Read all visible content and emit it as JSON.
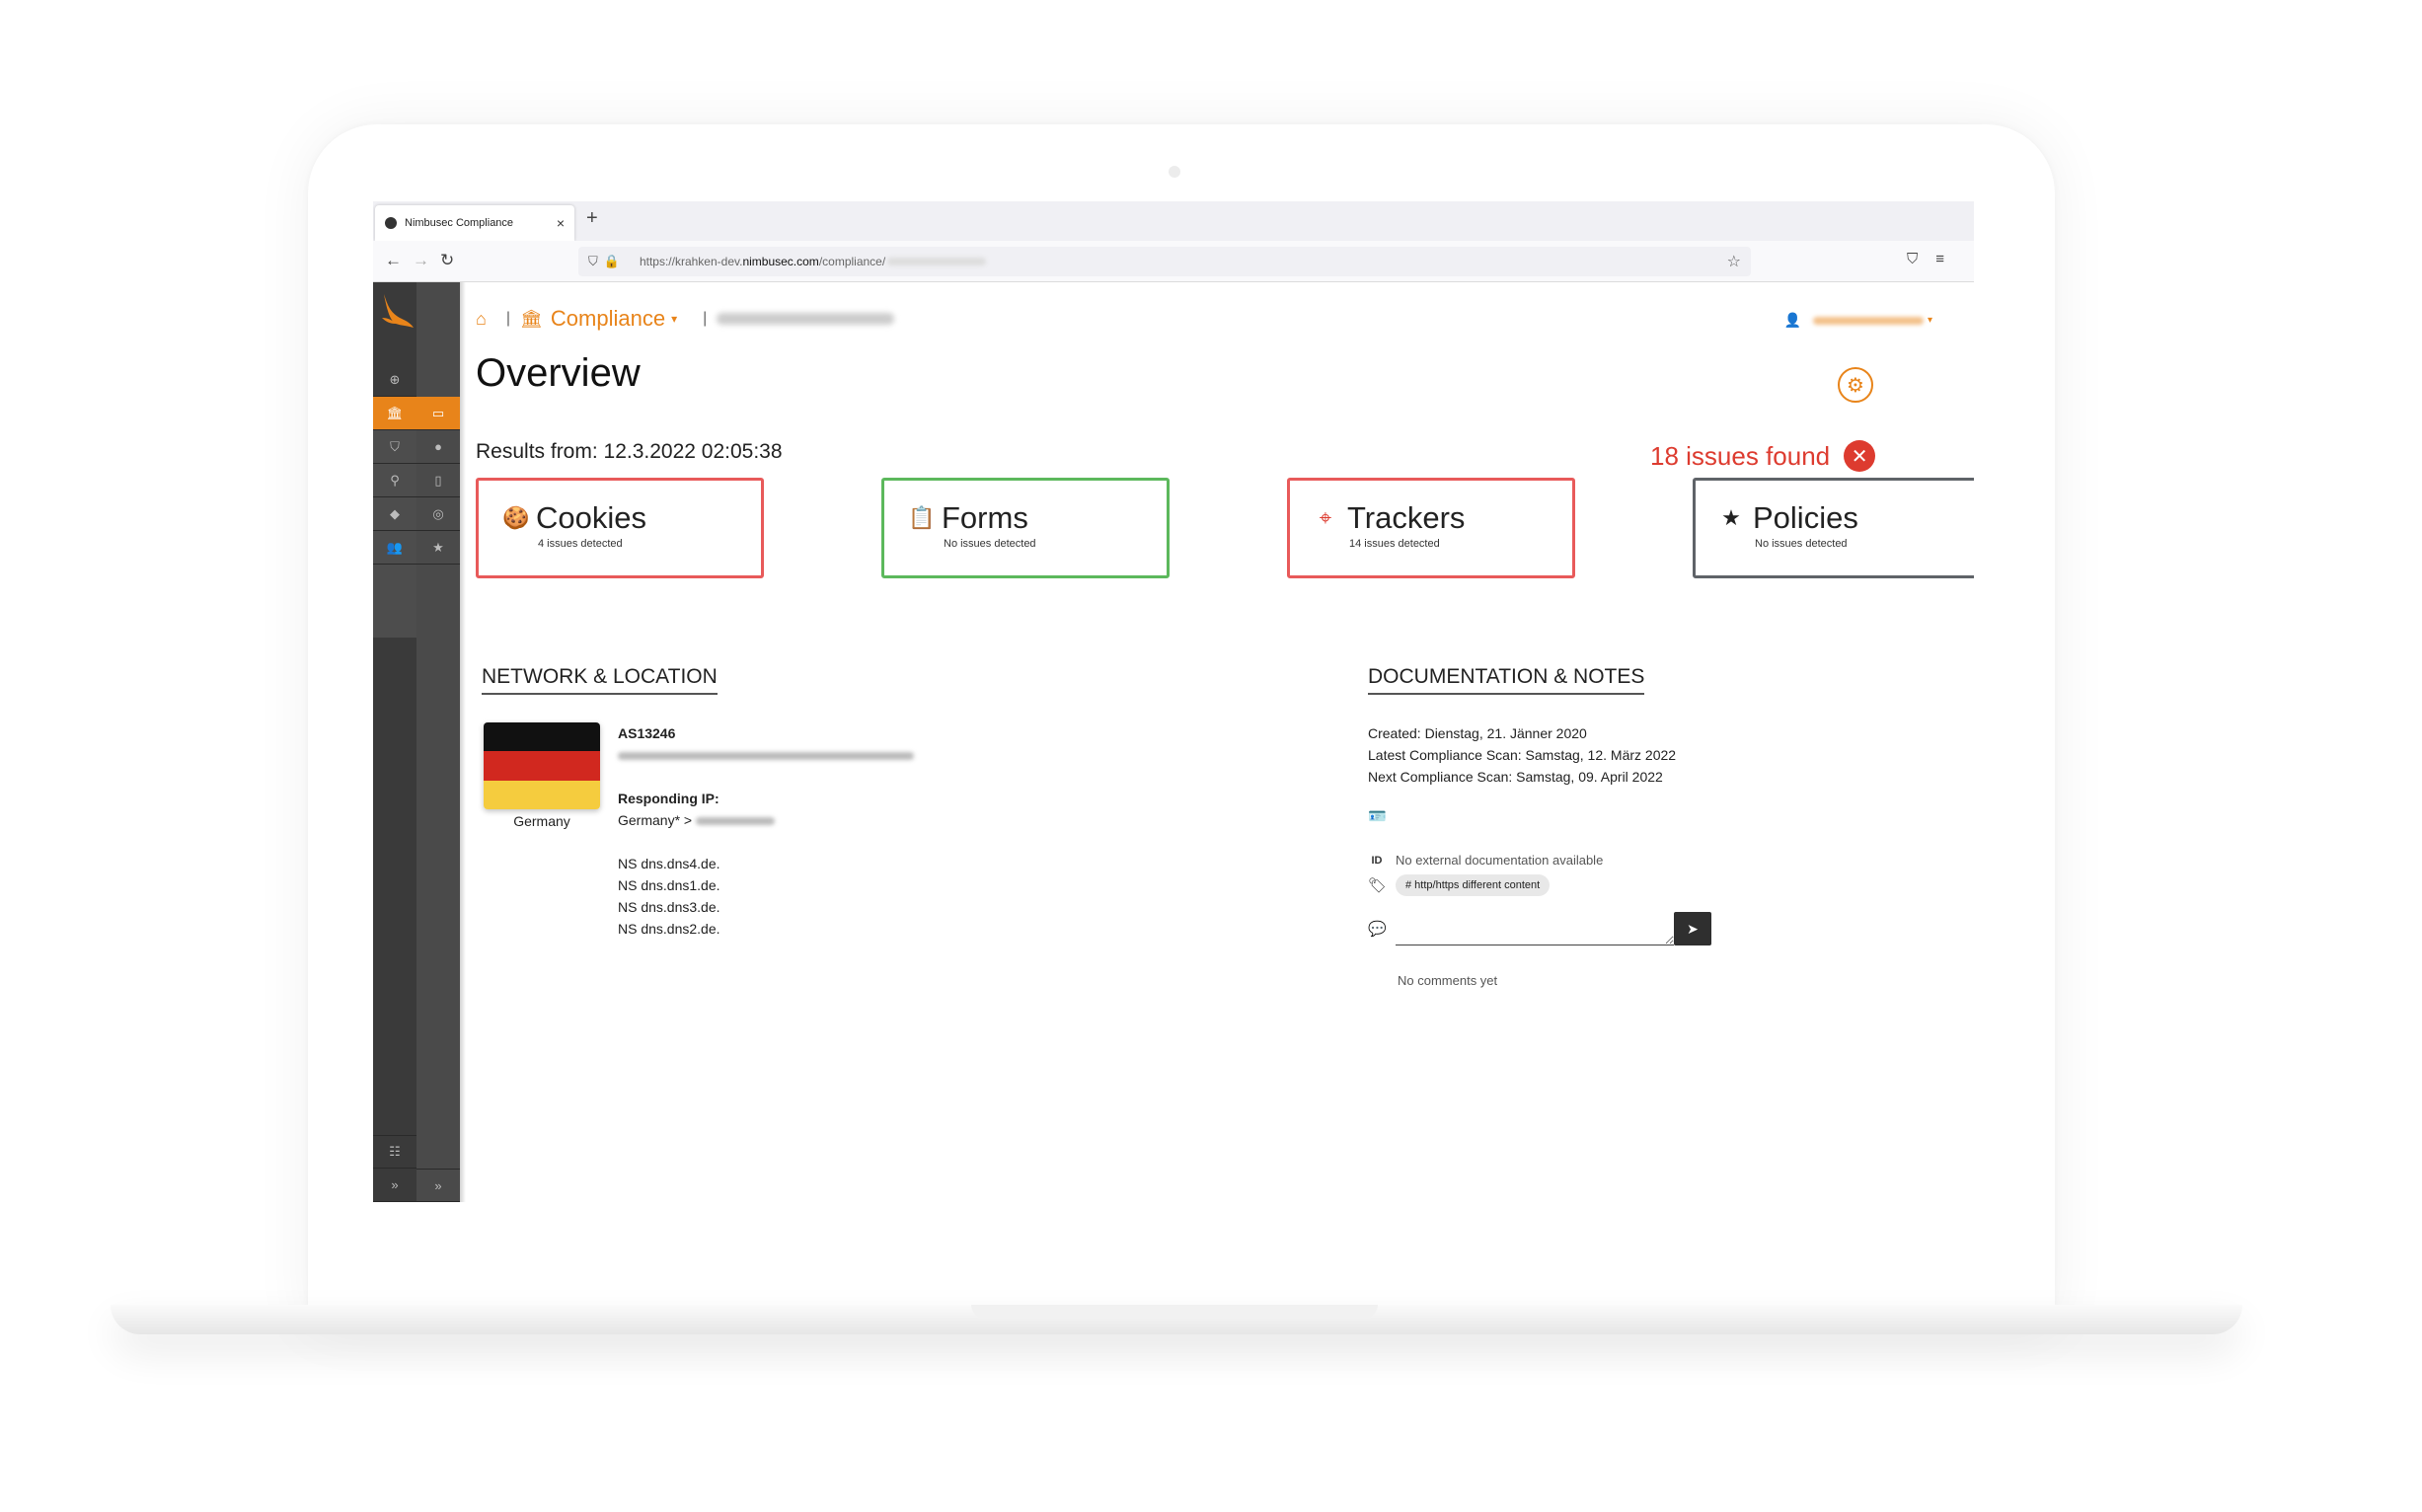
{
  "browser": {
    "tab_title": "Nimbusec Compliance",
    "tab_close": "×",
    "new_tab": "+",
    "url_prefix": "https://krahken-dev.",
    "url_domain": "nimbusec.com",
    "url_path": "/compliance/"
  },
  "breadcrumb": {
    "section": "Compliance",
    "separator": "|"
  },
  "page": {
    "title": "Overview",
    "results_from": "Results from: 12.3.2022 02:05:38",
    "issues_found": "18 issues found"
  },
  "cards": [
    {
      "title": "Cookies",
      "subtitle": "4 issues detected",
      "status": "red",
      "icon": "cookie-icon"
    },
    {
      "title": "Forms",
      "subtitle": "No issues detected",
      "status": "green",
      "icon": "clipboard-icon"
    },
    {
      "title": "Trackers",
      "subtitle": "14 issues detected",
      "status": "red",
      "icon": "crosshair-icon"
    },
    {
      "title": "Policies",
      "subtitle": "No issues detected",
      "status": "gray",
      "icon": "star-icon"
    }
  ],
  "network": {
    "section_title": "NETWORK & LOCATION",
    "country": "Germany",
    "asn": "AS13246",
    "responding_ip_label": "Responding IP:",
    "responding_ip_prefix": "Germany* >",
    "nameservers": [
      "NS dns.dns4.de.",
      "NS dns.dns1.de.",
      "NS dns.dns3.de.",
      "NS dns.dns2.de."
    ]
  },
  "documentation": {
    "section_title": "DOCUMENTATION & NOTES",
    "created": "Created: Dienstag, 21. Jänner 2020",
    "latest_scan": "Latest Compliance Scan: Samstag, 12. März 2022",
    "next_scan": "Next Compliance Scan: Samstag, 09. April 2022",
    "external_doc": "No external documentation available",
    "tag": "# http/https different content",
    "no_comments": "No comments yet",
    "send": "➤"
  },
  "colors": {
    "accent": "#e8841a",
    "error": "#dd3b2f",
    "success": "#5cb85c",
    "neutral": "#5f6368"
  }
}
